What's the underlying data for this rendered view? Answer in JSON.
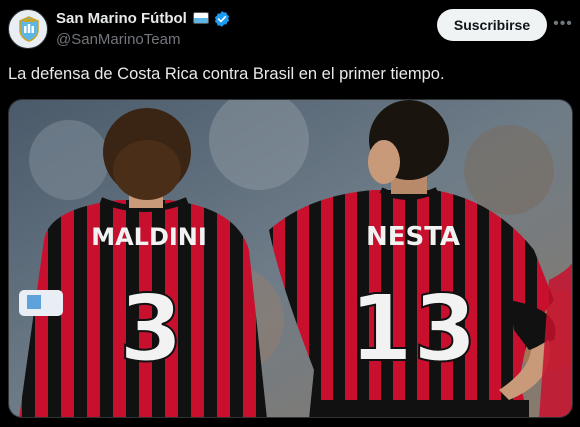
{
  "post": {
    "author_name": "San Marino Fútbol",
    "author_handle": "@SanMarinoTeam",
    "subscribe_label": "Suscribirse",
    "more_icon": "more-horizontal-icon",
    "verified_icon": "verified-badge-icon",
    "flag_icon": "san-marino-flag-icon",
    "text": "La defensa de Costa Rica contra Brasil en el primer tiempo."
  },
  "media": {
    "player_left_name": "MALDINI",
    "player_left_number": "3",
    "player_right_name": "NESTA",
    "player_right_number": "13"
  },
  "colors": {
    "background": "#000000",
    "text_primary": "#e7e9ea",
    "text_secondary": "#71767b",
    "verified_blue": "#1d9bf0",
    "jersey_red": "#c8102e",
    "jersey_black": "#111111"
  }
}
